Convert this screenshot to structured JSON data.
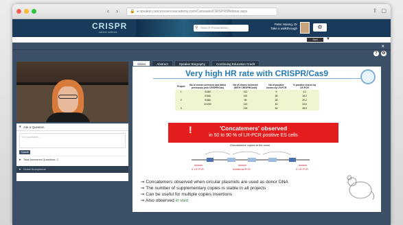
{
  "browser": {
    "url": "● speaker.cancerscienceacademy.com/Canvases/CRISPR/Webinar.aspx",
    "tab_icons": [
      "back-icon",
      "forward-icon"
    ]
  },
  "site": {
    "logo": "CRISPR",
    "logo_sub": "cancer science",
    "search_placeholder": "Search Presentation",
    "user_line1": "Peter Hsiang, Dr",
    "user_line2": "Take a walkthrough",
    "gear_label": "⚙",
    "subbar_control": "Sort"
  },
  "sidebar": {
    "qa_heading": "Ask a Question",
    "qa_placeholder": "Your question...",
    "qa_submit": "Submit",
    "qa_answered": "Total Answered Questions: 2",
    "anon_label": "Guest Anonymous"
  },
  "tabs": [
    {
      "label": "Slides",
      "active": true
    },
    {
      "label": "Abstract",
      "active": false
    },
    {
      "label": "Speaker Biography",
      "active": false
    },
    {
      "label": "Continuing Education Credit",
      "active": false
    }
  ],
  "slide": {
    "title": "Very high HR rate with CRISPR/Cas9",
    "table": {
      "headers": [
        "Project",
        "Nb of clones screened and failed previously (w/o CRISPR/Cas)",
        "Nb of clones screened (WITH CRISPR/Cas9)",
        "Nb of positive clones by LR-PCR",
        "% positive clones by LR-PCR"
      ],
      "rows": [
        [
          "1",
          "0/360",
          "212",
          "9",
          "4.2"
        ],
        [
          "",
          "0/360",
          "192",
          "35",
          "18.2"
        ],
        [
          "2",
          "0/360",
          "96",
          "28",
          "29.2"
        ],
        [
          "",
          "0/1200",
          "119",
          "40",
          "33.6"
        ],
        [
          "3",
          "",
          "218",
          "63",
          "28.9"
        ]
      ]
    },
    "banner_bang": "!",
    "banner_title": "'Concatemers' observed",
    "banner_sub": "in 50 to 90 % of LR-PCR positive ES cells",
    "diagram_title": "Concatemers copies at the locus",
    "diagram_labels": [
      "5' LR PCR",
      "Additional PCR",
      "3' LR PCR"
    ],
    "bullets": [
      "⇒ Concatemers observed when circular plasmids are used as donor DNA",
      "⇒ The number of supplementary copies is stable in all projects",
      "⇒ Can be useful for multiple copies insertions",
      "⇒ Also observed "
    ],
    "bullet_em": "in vivo"
  },
  "colors": {
    "accent": "#2779b4",
    "banner": "#e41e1e",
    "player_bg": "#3b4f66"
  }
}
